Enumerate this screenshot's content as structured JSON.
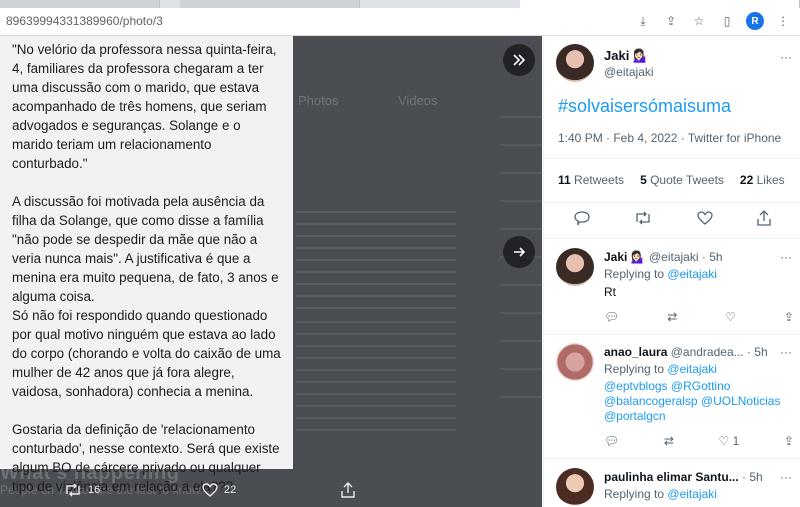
{
  "browser": {
    "url": "89639994331389960/photo/3",
    "profile_initial": "R"
  },
  "photo_text": {
    "p1": "\"No velório da professora nessa quinta-feira, 4, familiares da professora chegaram a ter uma discussão com o marido, que estava acompanhado de três homens, que seriam advogados e seguranças. Solange e o marido teriam um relacionamento conturbado.\"",
    "p2": "A discussão foi motivada pela ausência da filha da Solange, que como disse a família \"não pode se despedir da mãe que não a veria nunca mais\". A justificativa é que a menina era muito pequena, de fato, 3 anos e alguma coisa.",
    "p3": "Só não foi respondido quando questionado por qual motivo ninguém que estava ao lado do corpo (chorando e volta do caixão de uma mulher de 42 anos que já fora alegre, vaidosa, sonhadora) conhecia a menina.",
    "p4": "Gostaria da definição de 'relacionamento conturbado', nesse contexto. Será que existe algum BO de cárcere privado ou qualquer tipo de violência em relação a ela???"
  },
  "background": {
    "tab_photos": "Photos",
    "tab_videos": "Videos",
    "headline": "What's happening",
    "subline": "People on Twitter are the first to know."
  },
  "media_actions": {
    "retweets": "16",
    "likes": "22"
  },
  "tweet": {
    "name": "Jaki 💁🏻‍♀️",
    "handle": "@eitajaki",
    "hashtag": "#solvaisersómaisuma",
    "time": "1:40 PM · Feb 4, 2022 · Twitter for iPhone",
    "retweets_count": "11",
    "retweets_label": "Retweets",
    "quotes_count": "5",
    "quotes_label": "Quote Tweets",
    "likes_count": "22",
    "likes_label": "Likes"
  },
  "replies": [
    {
      "name": "Jaki 💁🏻‍♀️",
      "handle": "@eitajaki",
      "time": "· 5h",
      "replying_label": "Replying to",
      "replying_to": "@eitajaki",
      "body": "Rt"
    },
    {
      "name": "anao_laura",
      "handle": "@andradea...",
      "time": "· 5h",
      "replying_label": "Replying to",
      "replying_to": "@eitajaki",
      "mentions": [
        "@eptvblogs @RGottino",
        "@balancogeralsp @UOLNoticias",
        "@portalgcn"
      ],
      "likes": "1"
    },
    {
      "name": "paulinha elimar Santu...",
      "handle": "",
      "time": "· 5h",
      "replying_label": "Replying to",
      "replying_to": "@eitajaki"
    }
  ]
}
